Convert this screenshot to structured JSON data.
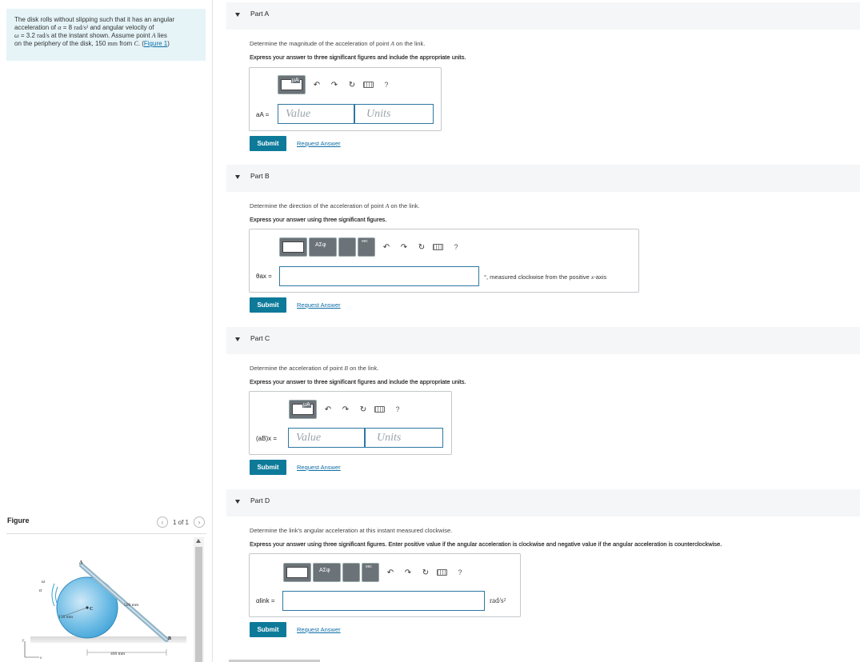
{
  "problem": {
    "line1": "The disk rolls without slipping such that it has an angular",
    "line2_a": "acceleration of ",
    "line2_sym": "α",
    "line2_b": " = 8 ",
    "line2_unit": "rad/s²",
    "line2_c": " and angular velocity of",
    "line3_sym": "ω",
    "line3_a": " = 3.2 ",
    "line3_unit": "rad/s",
    "line3_b": " at the instant shown. Assume point ",
    "line3_pt": "A",
    "line3_c": " lies",
    "line4_a": "on the periphery of the disk, 150 ",
    "line4_unit": "mm",
    "line4_b": " from ",
    "line4_pt": "C",
    "line4_c": ". (",
    "figure_link": "Figure 1",
    "line4_d": ")"
  },
  "figure": {
    "label": "Figure",
    "pager": "1 of 1",
    "dim_disk": "150 mm",
    "dim_link": "500 mm",
    "dim_base": "400 mm",
    "label_A": "A",
    "label_B": "B",
    "label_C": "C",
    "label_omega": "ω",
    "label_alpha": "α",
    "label_x": "x",
    "label_y": "y"
  },
  "toolbar": {
    "mu": "μA",
    "greek": "ΑΣφ",
    "vec": "vec",
    "help": "?"
  },
  "parts": {
    "a": {
      "title": "Part A",
      "question_a": "Determine the magnitude of the acceleration of point ",
      "question_pt": "A",
      "question_b": " on the link.",
      "instruction": "Express your answer to three significant figures and include the appropriate units.",
      "label": "aA =",
      "value_placeholder": "Value",
      "units_placeholder": "Units",
      "submit": "Submit",
      "request": "Request Answer"
    },
    "b": {
      "title": "Part B",
      "question_a": "Determine the direction of the acceleration of point ",
      "question_pt": "A",
      "question_b": " on the link.",
      "instruction": "Express your answer using three significant figures.",
      "label": "θax =",
      "after_a": "°, measured clockwise from the positive ",
      "after_x": "x",
      "after_b": "-axis",
      "submit": "Submit",
      "request": "Request Answer"
    },
    "c": {
      "title": "Part C",
      "question_a": "Determine the acceleration of point ",
      "question_pt": "B",
      "question_b": " on the link.",
      "instruction": "Express your answer to three significant figures and include the appropriate units.",
      "label": "(aB)x =",
      "value_placeholder": "Value",
      "units_placeholder": "Units",
      "submit": "Submit",
      "request": "Request Answer"
    },
    "d": {
      "title": "Part D",
      "question": "Determine the link's angular acceleration at this instant measured clockwise.",
      "instruction": "Express your answer using three significant figures. Enter positive value if the angular acceleration is clockwise and negative value if the angular acceleration is counterclockwise.",
      "label": "αlink =",
      "unit": "rad/s²",
      "submit": "Submit",
      "request": "Request Answer"
    }
  }
}
